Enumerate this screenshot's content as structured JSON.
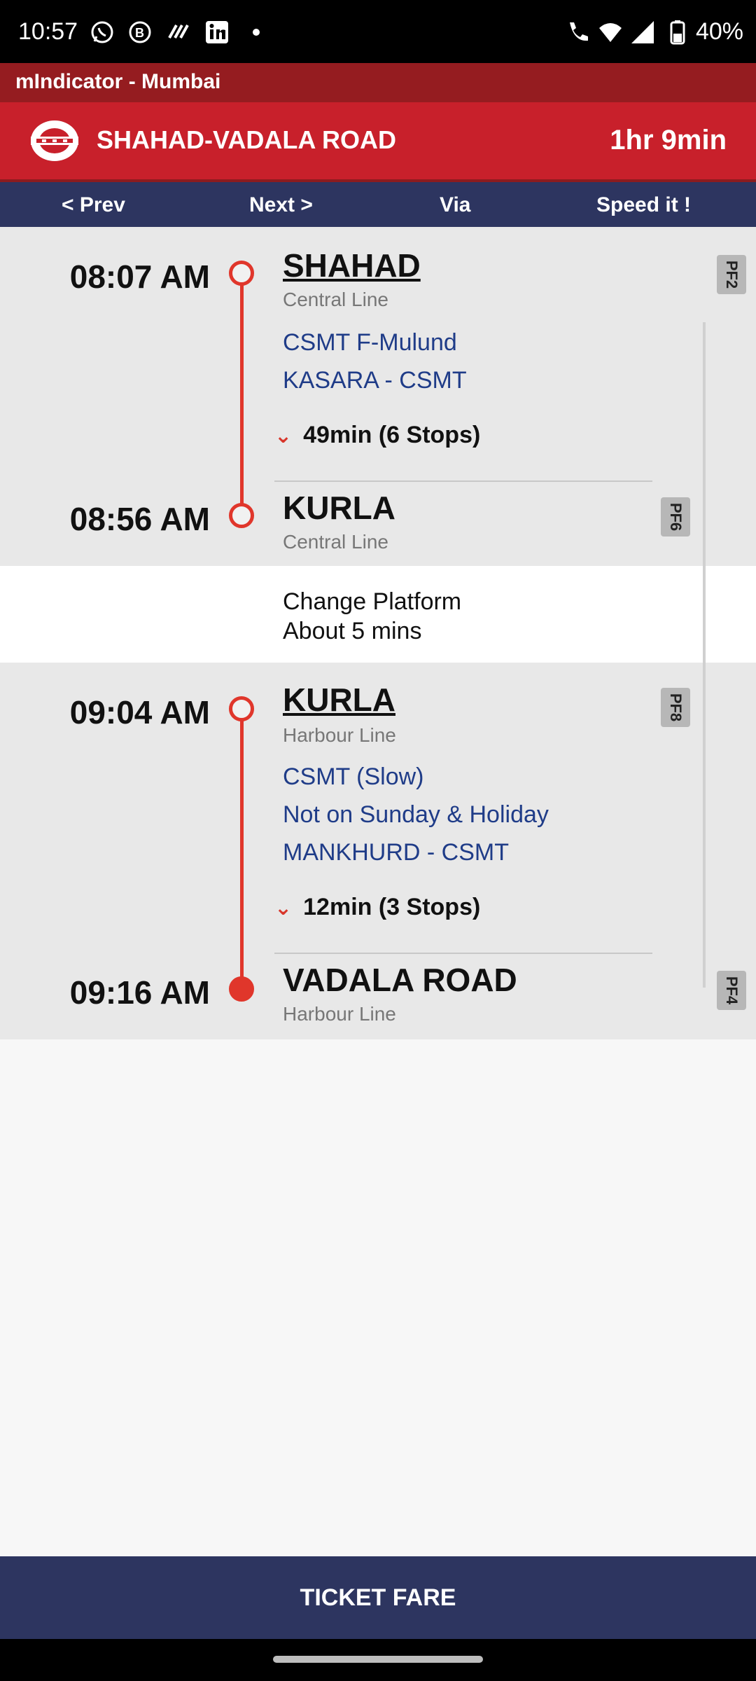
{
  "status_bar": {
    "time": "10:57",
    "battery": "40%",
    "icons": [
      "whatsapp-icon",
      "b-icon",
      "chat-icon",
      "linkedin-icon",
      "dot-icon",
      "wifi-call-icon",
      "wifi-icon",
      "signal-icon",
      "battery-icon"
    ]
  },
  "app": {
    "name": "mIndicator - Mumbai",
    "route_title": "SHAHAD-VADALA ROAD",
    "duration": "1hr 9min",
    "brand_color": "#c8202b"
  },
  "nav": {
    "prev": "< Prev",
    "next": "Next >",
    "via": "Via",
    "speed": "Speed it !"
  },
  "segments": [
    {
      "from_time": "08:07 AM",
      "from_station": "SHAHAD",
      "from_line": "Central Line",
      "from_pf": "PF2",
      "train_info": [
        "CSMT F-Mulund",
        "KASARA - CSMT"
      ],
      "stops_text": "49min (6 Stops)",
      "to_time": "08:56 AM",
      "to_station": "KURLA",
      "to_line": "Central Line",
      "to_pf": "PF6"
    },
    {
      "from_time": "09:04 AM",
      "from_station": "KURLA",
      "from_line": "Harbour Line",
      "from_pf": "PF8",
      "train_info": [
        "CSMT (Slow)",
        "Not on Sunday & Holiday",
        "MANKHURD - CSMT"
      ],
      "stops_text": "12min (3 Stops)",
      "to_time": "09:16 AM",
      "to_station": "VADALA ROAD",
      "to_line": "Harbour Line",
      "to_pf": "PF4"
    }
  ],
  "change": {
    "line1": "Change Platform",
    "line2": "About 5 mins"
  },
  "ticket": {
    "label": "TICKET FARE"
  }
}
